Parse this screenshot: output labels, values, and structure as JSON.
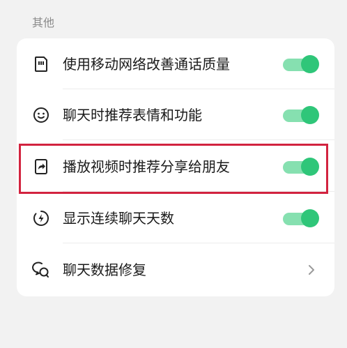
{
  "section": {
    "title": "其他"
  },
  "rows": [
    {
      "label": "使用移动网络改善通话质量",
      "icon": "sim-card-icon",
      "control": "toggle",
      "checked": true
    },
    {
      "label": "聊天时推荐表情和功能",
      "icon": "emoji-icon",
      "control": "toggle",
      "checked": true
    },
    {
      "label": "播放视频时推荐分享给朋友",
      "icon": "share-video-icon",
      "control": "toggle",
      "checked": true
    },
    {
      "label": "显示连续聊天天数",
      "icon": "flash-icon",
      "control": "toggle",
      "checked": true
    },
    {
      "label": "聊天数据修复",
      "icon": "chat-repair-icon",
      "control": "chevron"
    }
  ],
  "colors": {
    "toggle_on": "#2fc679",
    "toggle_track_on": "#86e0b0",
    "highlight": "#d2233f"
  }
}
